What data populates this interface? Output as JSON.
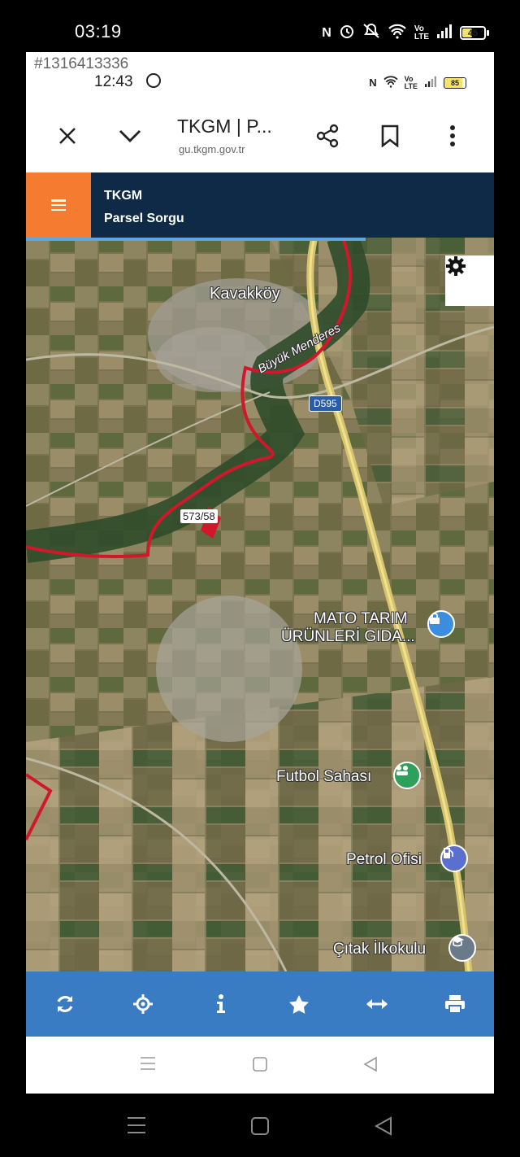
{
  "outer_status": {
    "time": "03:19",
    "battery": "45"
  },
  "inner_status": {
    "tag": "#1316413336",
    "time": "12:43",
    "battery": "85"
  },
  "browser": {
    "title": "TKGM | P...",
    "url": "gu.tkgm.gov.tr",
    "icons": [
      "close-icon",
      "chevron-down-icon",
      "share-icon",
      "bookmark-icon",
      "more-vert-icon"
    ]
  },
  "app_header": {
    "title": "TKGM",
    "subtitle": "Parsel Sorgu",
    "menu_color": "#f47b30",
    "header_color": "#0e2a47"
  },
  "map": {
    "village_label": "Kavakköy",
    "river_label": "Büyük Menderes",
    "road_shield": "D595",
    "parcel_label": "573/58",
    "poi": [
      {
        "name": "MATO TARIM",
        "name2": "ÜRÜNLERİ GIDA...",
        "icon": "lock-pin-icon"
      },
      {
        "name": "Futbol Sahası",
        "icon": "sports-pin-icon"
      },
      {
        "name": "Petrol Ofisi",
        "icon": "fuel-pin-icon"
      },
      {
        "name": "Çıtak İlkokulu",
        "icon": "school-pin-icon"
      }
    ],
    "parcel_border_color": "#d0182a"
  },
  "toolbar": {
    "color": "#3a7cc4",
    "items": [
      "refresh-icon",
      "locate-icon",
      "info-icon",
      "star-icon",
      "measure-icon",
      "print-icon"
    ]
  }
}
